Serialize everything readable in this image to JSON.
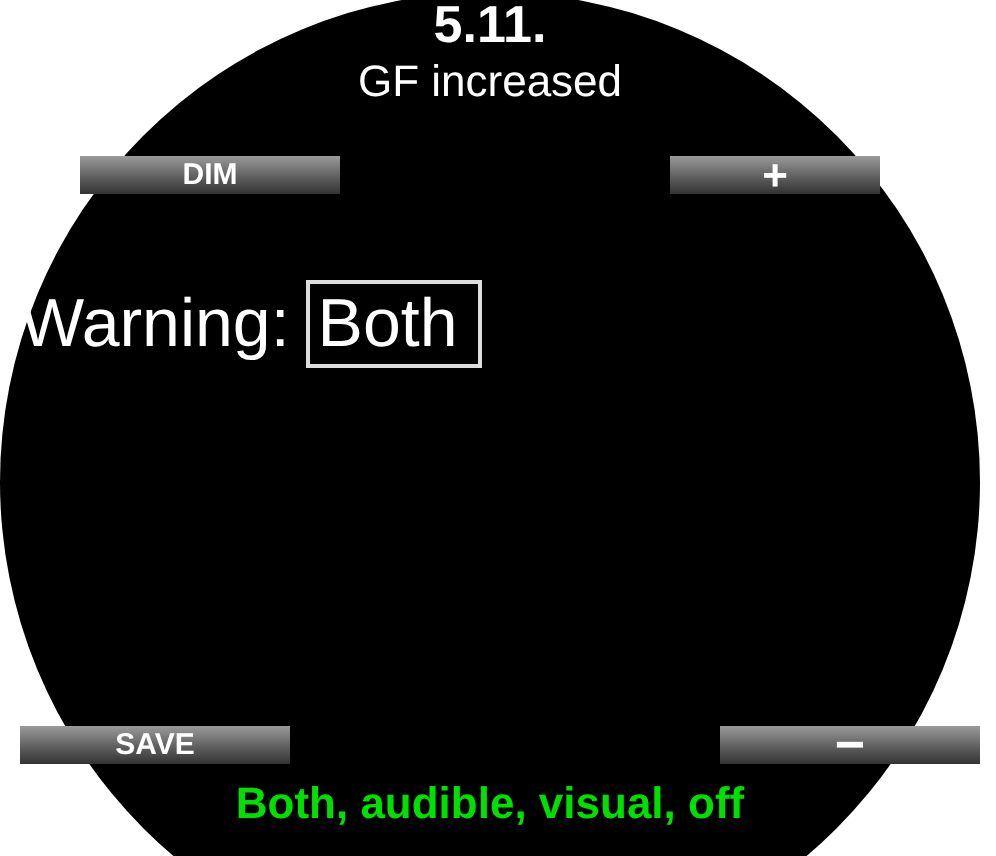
{
  "header": {
    "title": "5.11.",
    "subtitle": "GF increased"
  },
  "top_buttons": [
    {
      "label": "DIM"
    },
    {
      "label": "+"
    }
  ],
  "setting": {
    "label": "Warning:",
    "value": "Both"
  },
  "bottom_buttons": [
    {
      "label": "SAVE"
    },
    {
      "label": "−"
    }
  ],
  "hint": "Both, audible, visual, off"
}
